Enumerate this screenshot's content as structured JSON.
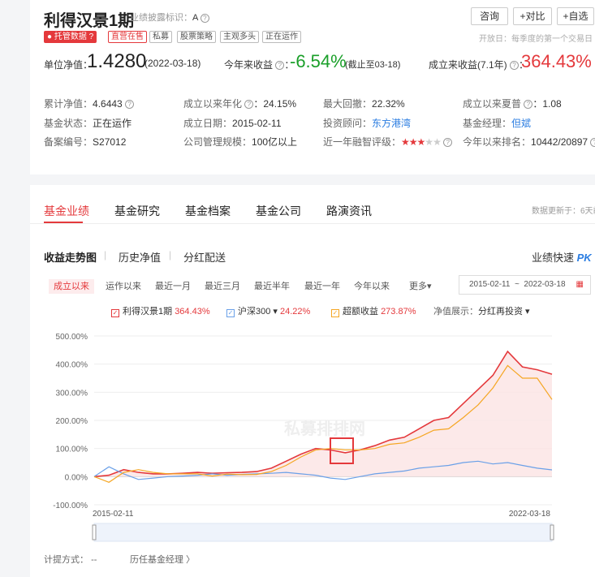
{
  "header": {
    "fund_name": "利得汉景1期",
    "disclosure_label": "业绩披露标识：",
    "disclosure_value": "A",
    "buttons": [
      "咨询",
      "+对比",
      "+自选"
    ],
    "tags": [
      "托管数据",
      "直营在售",
      "私募",
      "股票策略",
      "主观多头",
      "正在运作"
    ],
    "open_date_text": "开放日：每季度的第一个交易日",
    "nav_label": "单位净值：",
    "nav_value": "1.4280",
    "nav_date": "(2022-03-18)",
    "ytd_label": "今年来收益",
    "ytd_value": "-6.54%",
    "ytd_note": "(截止至03-18)",
    "since_label": "成立来收益(7.1年)",
    "since_value": "364.43%"
  },
  "info": {
    "row1": [
      {
        "label": "累计净值：",
        "value": "4.6443"
      },
      {
        "label": "成立以来年化",
        "value": "24.15%"
      },
      {
        "label": "最大回撤：",
        "value": "22.32%"
      },
      {
        "label": "成立以来夏普",
        "value": "1.08"
      }
    ],
    "row2": [
      {
        "label": "基金状态：",
        "value": "正在运作"
      },
      {
        "label": "成立日期：",
        "value": "2015-02-11"
      },
      {
        "label": "投资顾问：",
        "value": "东方港湾"
      },
      {
        "label": "基金经理：",
        "value": "但斌"
      }
    ],
    "row3": [
      {
        "label": "备案编号：",
        "value": "S27012"
      },
      {
        "label": "公司管理规模：",
        "value": "100亿以上"
      },
      {
        "label": "近一年融智评级：",
        "value": ""
      },
      {
        "label": "今年以来排名：",
        "value": "10442/20897"
      }
    ],
    "rating_stars": 3
  },
  "tabs": {
    "items": [
      "基金业绩",
      "基金研究",
      "基金档案",
      "基金公司",
      "路演资讯"
    ],
    "update_text": "数据更新于：6天前"
  },
  "subtabs": {
    "items": [
      "收益走势图",
      "历史净值",
      "分红配送"
    ],
    "pk_label": "业绩快速",
    "pk_mark": "PK"
  },
  "ranges": {
    "items": [
      "成立以来",
      "运作以来",
      "最近一月",
      "最近三月",
      "最近半年",
      "最近一年",
      "今年以来",
      "更多▾"
    ],
    "date_start": "2015-02-11",
    "date_sep": "~",
    "date_end": "2022-03-18"
  },
  "legend": {
    "fund": {
      "name": "利得汉景1期",
      "value": "364.43%",
      "color": "#e4393c"
    },
    "bench": {
      "name": "沪深300 ▾",
      "value": "24.22%",
      "color": "#6aa0e8"
    },
    "excess": {
      "name": "超额收益",
      "value": "273.87%",
      "color": "#f5a623"
    },
    "nav_display_label": "净值展示：",
    "nav_display_value": "分红再投资 ▾"
  },
  "chart_data": {
    "type": "line",
    "ylim": [
      -100,
      500
    ],
    "yticks": [
      "500.00%",
      "400.00%",
      "300.00%",
      "200.00%",
      "100.00%",
      "0.00%",
      "-100.00%"
    ],
    "x_start": "2015-02-11",
    "x_end": "2022-03-18",
    "watermark": "私募排排网",
    "series": [
      {
        "name": "利得汉景1期",
        "color": "#e4393c",
        "values": [
          0,
          5,
          25,
          15,
          10,
          10,
          12,
          15,
          12,
          14,
          15,
          18,
          30,
          55,
          80,
          100,
          95,
          85,
          95,
          110,
          130,
          140,
          170,
          200,
          210,
          260,
          310,
          360,
          445,
          390,
          380,
          364
        ]
      },
      {
        "name": "沪深300",
        "color": "#6aa0e8",
        "values": [
          0,
          35,
          10,
          -10,
          -5,
          0,
          2,
          5,
          10,
          5,
          8,
          10,
          12,
          15,
          10,
          5,
          -5,
          -10,
          0,
          10,
          15,
          20,
          30,
          35,
          40,
          50,
          55,
          45,
          50,
          40,
          30,
          24
        ]
      },
      {
        "name": "超额收益",
        "color": "#f5a623",
        "values": [
          0,
          -20,
          15,
          25,
          15,
          10,
          10,
          10,
          2,
          9,
          7,
          8,
          18,
          40,
          70,
          95,
          100,
          95,
          95,
          100,
          115,
          120,
          140,
          165,
          170,
          210,
          255,
          315,
          395,
          350,
          350,
          274
        ]
      }
    ]
  },
  "footer": {
    "calc_label": "计提方式：",
    "calc_value": "--",
    "history_link": "历任基金经理 〉"
  },
  "colors": {
    "accent": "#e4393c",
    "up": "#e4393c",
    "down": "#1a9f29",
    "link": "#2b7de1"
  }
}
